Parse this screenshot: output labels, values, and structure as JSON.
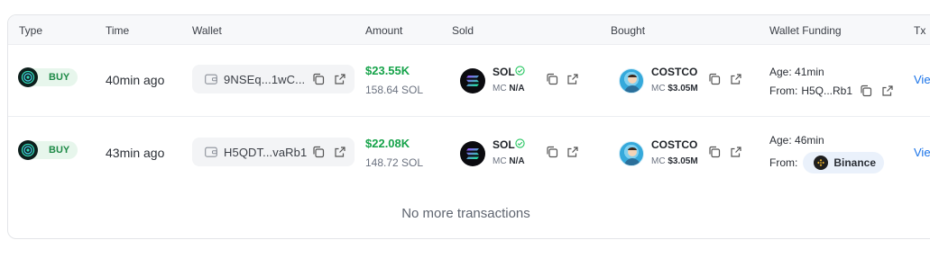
{
  "headers": {
    "type": "Type",
    "time": "Time",
    "wallet": "Wallet",
    "amount": "Amount",
    "sold": "Sold",
    "bought": "Bought",
    "funding": "Wallet Funding",
    "tx": "Tx"
  },
  "rows": [
    {
      "type": "BUY",
      "time": "40min ago",
      "wallet": "9NSEq...1wC...",
      "amount": "$23.55K",
      "amount_sol": "158.64 SOL",
      "sold": {
        "name": "SOL",
        "mc_label": "MC",
        "mc": "N/A",
        "icon": "solana-icon"
      },
      "bought": {
        "name": "COSTCO",
        "mc_label": "MC",
        "mc": "$3.05M",
        "icon": "costco-avatar"
      },
      "funding": {
        "age": "Age: 41min",
        "from_label": "From:",
        "from_value": "H5Q...Rb1"
      },
      "tx": "View"
    },
    {
      "type": "BUY",
      "time": "43min ago",
      "wallet": "H5QDT...vaRb1",
      "amount": "$22.08K",
      "amount_sol": "148.72 SOL",
      "sold": {
        "name": "SOL",
        "mc_label": "MC",
        "mc": "N/A",
        "icon": "solana-icon"
      },
      "bought": {
        "name": "COSTCO",
        "mc_label": "MC",
        "mc": "$3.05M",
        "icon": "costco-avatar"
      },
      "funding": {
        "age": "Age: 46min",
        "from_label": "From:",
        "from_value": "Binance",
        "from_icon": "binance-icon"
      },
      "tx": "View"
    }
  ],
  "footer": {
    "no_more": "No more transactions"
  },
  "colors": {
    "buy_green": "#16a34a",
    "badge_bg": "#e7f6ec",
    "link_blue": "#1a73e8",
    "verified_green": "#22c55e"
  }
}
